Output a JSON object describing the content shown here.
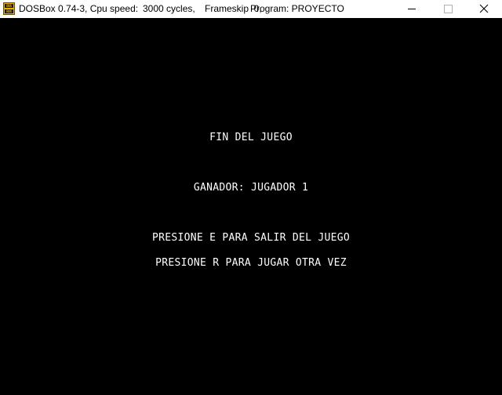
{
  "window": {
    "app_icon": "dosbox-icon",
    "title_app": "DOSBox 0.74-3, Cpu speed:",
    "title_speed": "3000 cycles,",
    "title_frameskip": "Frameskip  0,",
    "title_program": "Program: PROYECTO",
    "controls": {
      "minimize": "minimize-icon",
      "maximize": "maximize-icon",
      "close": "close-icon"
    }
  },
  "screen": {
    "title": "FIN DEL JUEGO",
    "winner": "GANADOR: JUGADOR 1",
    "exit_prompt": "PRESIONE E PARA SALIR DEL JUEGO",
    "replay_prompt": "PRESIONE R PARA JUGAR OTRA VEZ"
  },
  "colors": {
    "titlebar_bg": "#ffffff",
    "screen_bg": "#000000",
    "screen_text": "#ffffff"
  }
}
